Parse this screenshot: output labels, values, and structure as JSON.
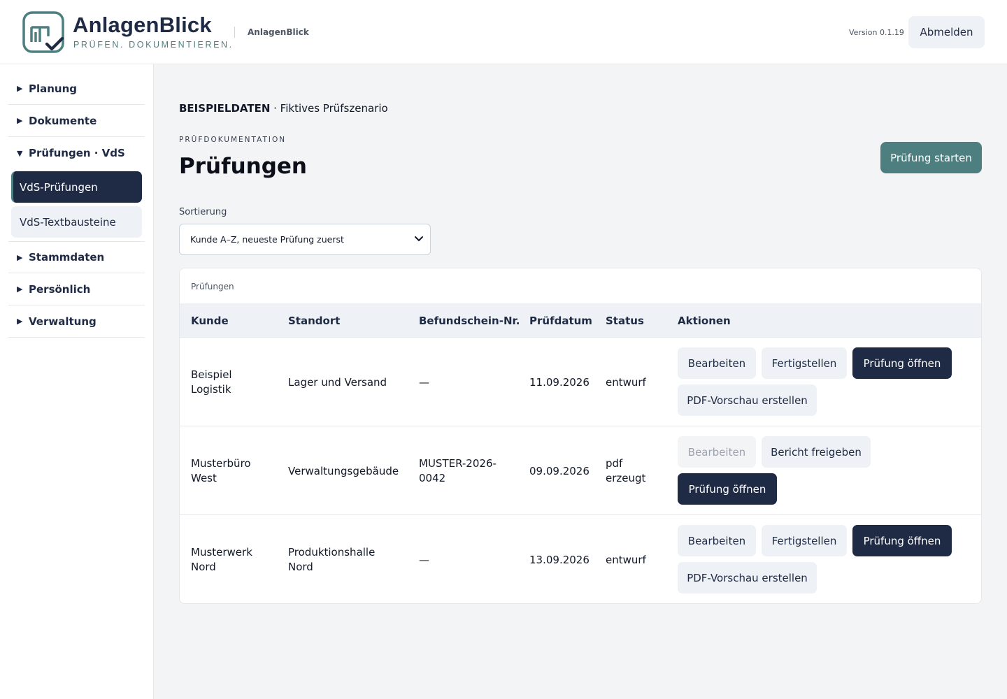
{
  "header": {
    "brand_title": "AnlagenBlick",
    "brand_tagline": "PRÜFEN. DOKUMENTIEREN.",
    "app_name": "AnlagenBlick",
    "version": "Version 0.1.19",
    "logout_label": "Abmelden"
  },
  "colors": {
    "brand_navy": "#1f2a44",
    "brand_teal": "#4d7f80"
  },
  "sidebar": {
    "groups": [
      {
        "label": "Planung",
        "expanded": false
      },
      {
        "label": "Dokumente",
        "expanded": false
      },
      {
        "label": "Prüfungen · VdS",
        "expanded": true,
        "items": [
          {
            "label": "VdS-Prüfungen",
            "active": true
          },
          {
            "label": "VdS-Textbausteine",
            "active": false
          }
        ]
      },
      {
        "label": "Stammdaten",
        "expanded": false
      },
      {
        "label": "Persönlich",
        "expanded": false
      },
      {
        "label": "Verwaltung",
        "expanded": false
      }
    ]
  },
  "main": {
    "demo_badge": "BEISPIELDATEN",
    "demo_text": " · Fiktives Prüfszenario",
    "eyebrow": "PRÜFDOKUMENTATION",
    "title": "Prüfungen",
    "start_button": "Prüfung starten",
    "sort": {
      "label": "Sortierung",
      "selected": "Kunde A–Z, neueste Prüfung zuerst"
    },
    "table": {
      "caption": "Prüfungen",
      "columns": [
        "Kunde",
        "Standort",
        "Befundschein-Nr.",
        "Prüfdatum",
        "Status",
        "Aktionen"
      ],
      "rows": [
        {
          "kunde": "Beispiel Logistik",
          "standort": "Lager und Versand",
          "befundschein": "—",
          "datum": "11.09.2026",
          "status": "entwurf",
          "actions": [
            "Bearbeiten",
            "Fertigstellen",
            "Prüfung öffnen",
            "PDF-Vorschau erstellen"
          ]
        },
        {
          "kunde": "Musterbüro West",
          "standort": "Verwaltungsgebäude",
          "befundschein": "MUSTER-2026-0042",
          "datum": "09.09.2026",
          "status": "pdf erzeugt",
          "actions": [
            "Bearbeiten",
            "Bericht freigeben",
            "Prüfung öffnen"
          ]
        },
        {
          "kunde": "Musterwerk Nord",
          "standort": "Produktionshalle Nord",
          "befundschein": "—",
          "datum": "13.09.2026",
          "status": "entwurf",
          "actions": [
            "Bearbeiten",
            "Fertigstellen",
            "Prüfung öffnen",
            "PDF-Vorschau erstellen"
          ]
        }
      ]
    }
  }
}
